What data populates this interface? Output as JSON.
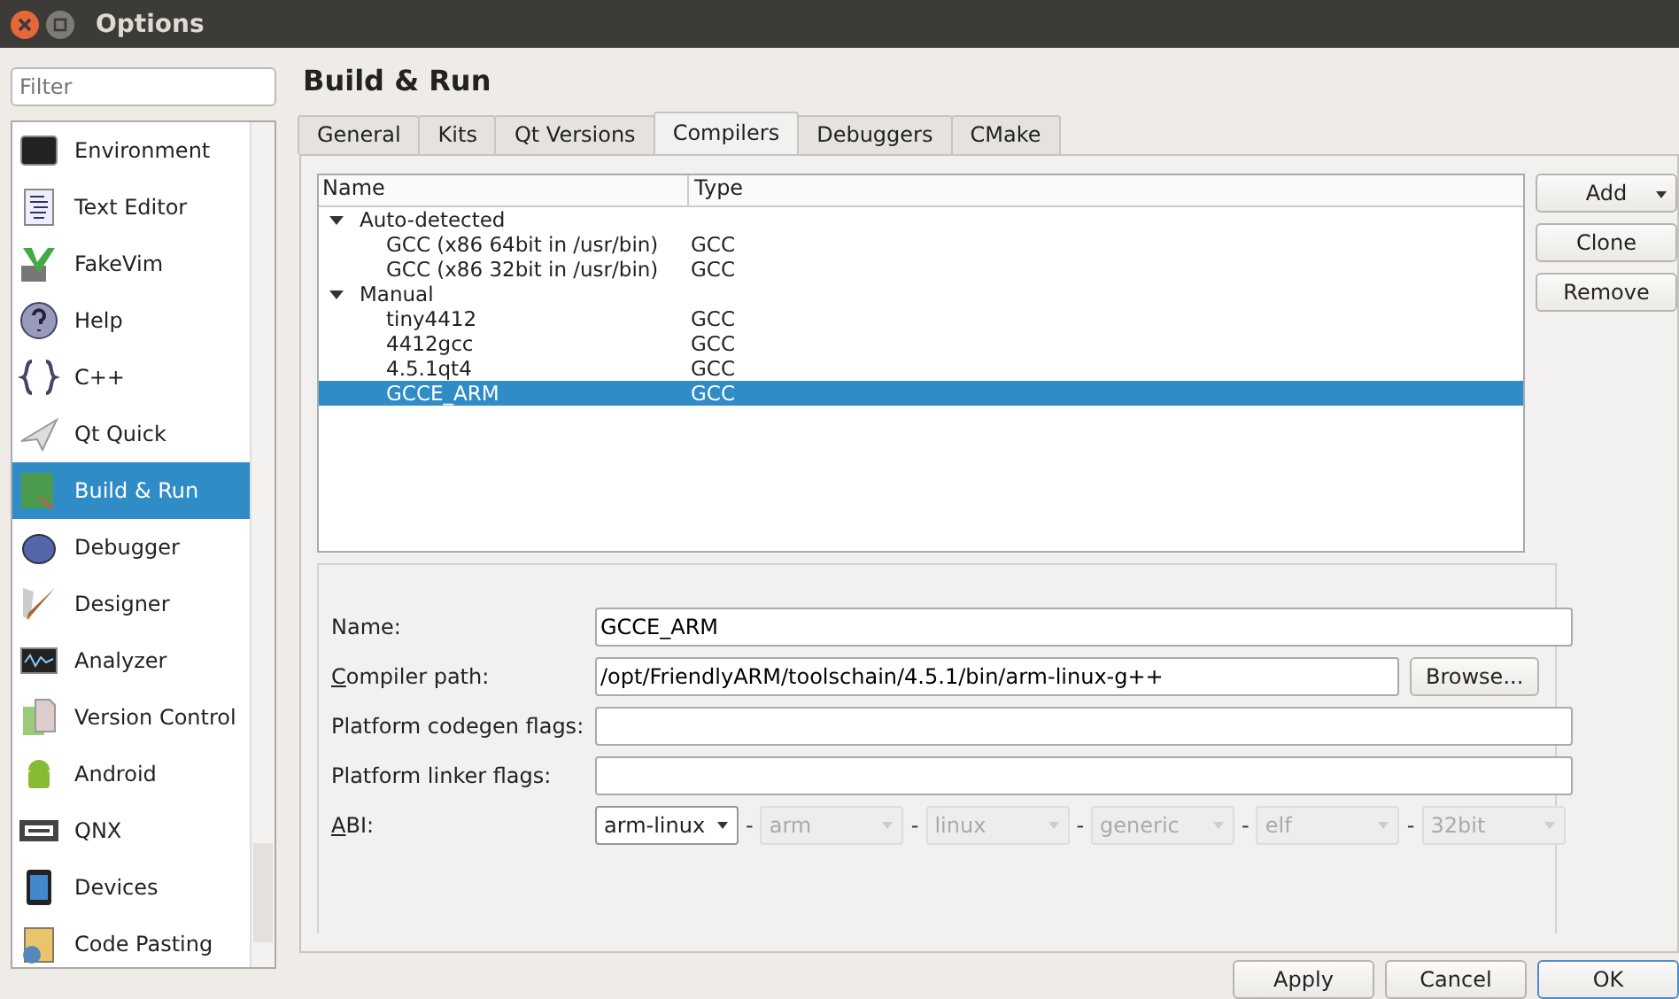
{
  "window": {
    "title": "Options"
  },
  "filter": {
    "placeholder": "Filter"
  },
  "sidebar": {
    "items": [
      {
        "label": "Environment",
        "selected": false
      },
      {
        "label": "Text Editor",
        "selected": false
      },
      {
        "label": "FakeVim",
        "selected": false
      },
      {
        "label": "Help",
        "selected": false
      },
      {
        "label": "C++",
        "selected": false
      },
      {
        "label": "Qt Quick",
        "selected": false
      },
      {
        "label": "Build & Run",
        "selected": true
      },
      {
        "label": "Debugger",
        "selected": false
      },
      {
        "label": "Designer",
        "selected": false
      },
      {
        "label": "Analyzer",
        "selected": false
      },
      {
        "label": "Version Control",
        "selected": false
      },
      {
        "label": "Android",
        "selected": false
      },
      {
        "label": "QNX",
        "selected": false
      },
      {
        "label": "Devices",
        "selected": false
      },
      {
        "label": "Code Pasting",
        "selected": false
      }
    ]
  },
  "page_title": "Build & Run",
  "tabs": [
    {
      "label": "General",
      "selected": false
    },
    {
      "label": "Kits",
      "selected": false
    },
    {
      "label": "Qt Versions",
      "selected": false
    },
    {
      "label": "Compilers",
      "selected": true
    },
    {
      "label": "Debuggers",
      "selected": false
    },
    {
      "label": "CMake",
      "selected": false
    }
  ],
  "table": {
    "columns": [
      "Name",
      "Type"
    ],
    "rows": [
      {
        "name": "Auto-detected",
        "expanded": true,
        "children": [
          {
            "name": "GCC (x86 64bit in /usr/bin)",
            "type": "GCC",
            "selected": false
          },
          {
            "name": "GCC (x86 32bit in /usr/bin)",
            "type": "GCC",
            "selected": false
          }
        ]
      },
      {
        "name": "Manual",
        "expanded": true,
        "children": [
          {
            "name": "tiny4412",
            "type": "GCC",
            "selected": false
          },
          {
            "name": "4412gcc",
            "type": "GCC",
            "selected": false
          },
          {
            "name": "4.5.1qt4",
            "type": "GCC",
            "selected": false
          },
          {
            "name": "GCCE_ARM",
            "type": "GCC",
            "selected": true
          }
        ]
      }
    ]
  },
  "side_buttons": [
    {
      "label": "Add",
      "kind": "menu"
    },
    {
      "label": "Clone",
      "kind": "plain"
    },
    {
      "label": "Remove",
      "kind": "plain"
    }
  ],
  "form": {
    "name": {
      "label": "Name:",
      "value": "GCCE_ARM"
    },
    "compiler_path": {
      "mnemonic": "C",
      "rest": "ompiler path:",
      "value": "/opt/FriendlyARM/toolschain/4.5.1/bin/arm-linux-g++",
      "button": "Browse..."
    },
    "codegen_flags": {
      "label": "Platform codegen flags:"
    },
    "linker_flags": {
      "label": "Platform linker flags:"
    },
    "abi": {
      "mnemonic": "A",
      "rest": "BI:",
      "parts": [
        {
          "value": "arm-linux",
          "disabled": false
        },
        {
          "value": "arm",
          "disabled": true
        },
        {
          "value": "linux",
          "disabled": true
        },
        {
          "value": "generic",
          "disabled": true
        },
        {
          "value": "elf",
          "disabled": true
        },
        {
          "value": "32bit",
          "disabled": true
        }
      ],
      "separator": "-"
    }
  },
  "footer_buttons": [
    "Apply",
    "Cancel",
    "OK"
  ]
}
